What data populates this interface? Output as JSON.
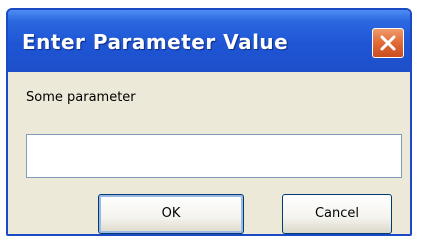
{
  "dialog": {
    "title": "Enter Parameter Value",
    "prompt": "Some parameter",
    "input_value": "",
    "ok_label": "OK",
    "cancel_label": "Cancel",
    "close_icon": "close-icon"
  },
  "colors": {
    "titlebar": "#1f55d4",
    "close_button": "#e06a36",
    "window_background": "#ece9d8"
  }
}
